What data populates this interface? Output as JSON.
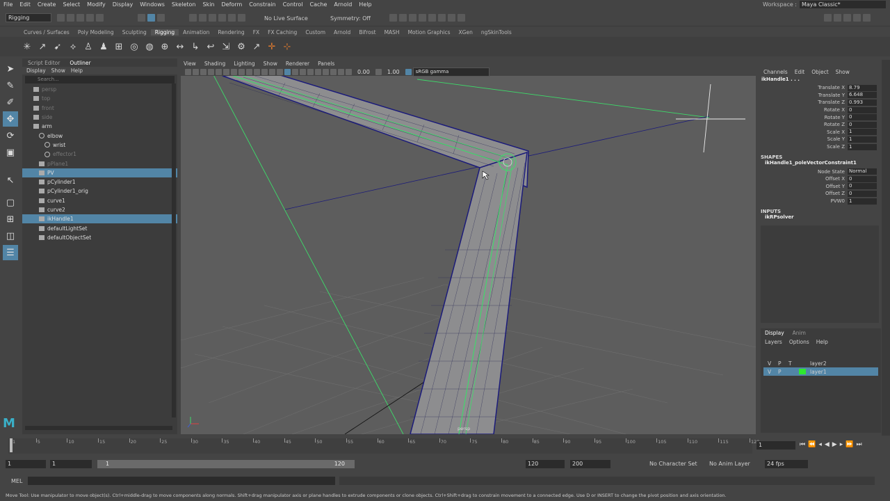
{
  "menu": [
    "File",
    "Edit",
    "Create",
    "Select",
    "Modify",
    "Display",
    "Windows",
    "Skeleton",
    "Skin",
    "Deform",
    "Constrain",
    "Control",
    "Cache",
    "Arnold",
    "Help"
  ],
  "workspace": {
    "label": "Workspace :",
    "value": "Maya Classic*"
  },
  "status": {
    "mode": "Rigging",
    "live_surface": "No Live Surface",
    "symmetry": "Symmetry: Off"
  },
  "shelf_tabs": [
    "Curves / Surfaces",
    "Poly Modeling",
    "Sculpting",
    "Rigging",
    "Animation",
    "Rendering",
    "FX",
    "FX Caching",
    "Custom",
    "Arnold",
    "Bifrost",
    "MASH",
    "Motion Graphics",
    "XGen",
    "ngSkinTools"
  ],
  "shelf_active": "Rigging",
  "outliner": {
    "tabs": [
      "Script Editor",
      "Outliner"
    ],
    "menu": [
      "Display",
      "Show",
      "Help"
    ],
    "search_placeholder": "Search...",
    "rows": [
      {
        "label": "persp",
        "indent": 1,
        "dim": true,
        "sel": false
      },
      {
        "label": "top",
        "indent": 1,
        "dim": true,
        "sel": false
      },
      {
        "label": "front",
        "indent": 1,
        "dim": true,
        "sel": false
      },
      {
        "label": "side",
        "indent": 1,
        "dim": true,
        "sel": false
      },
      {
        "label": "arm",
        "indent": 1,
        "dim": false,
        "sel": false
      },
      {
        "label": "elbow",
        "indent": 2,
        "dim": false,
        "sel": false
      },
      {
        "label": "wrist",
        "indent": 3,
        "dim": false,
        "sel": false
      },
      {
        "label": "effector1",
        "indent": 3,
        "dim": true,
        "sel": false
      },
      {
        "label": "pPlane1",
        "indent": 2,
        "dim": true,
        "sel": false
      },
      {
        "label": "PV",
        "indent": 2,
        "dim": false,
        "sel": true
      },
      {
        "label": "pCylinder1",
        "indent": 2,
        "dim": false,
        "sel": false
      },
      {
        "label": "pCylinder1_orig",
        "indent": 2,
        "dim": false,
        "sel": false
      },
      {
        "label": "curve1",
        "indent": 2,
        "dim": false,
        "sel": false
      },
      {
        "label": "curve2",
        "indent": 2,
        "dim": false,
        "sel": false
      },
      {
        "label": "ikHandle1",
        "indent": 2,
        "dim": false,
        "sel": true
      },
      {
        "label": "defaultLightSet",
        "indent": 2,
        "dim": false,
        "sel": false
      },
      {
        "label": "defaultObjectSet",
        "indent": 2,
        "dim": false,
        "sel": false
      }
    ]
  },
  "viewport": {
    "menu": [
      "View",
      "Shading",
      "Lighting",
      "Show",
      "Renderer",
      "Panels"
    ],
    "exposure": "0.00",
    "gamma": "1.00",
    "colorspace": "sRGB gamma",
    "camera": "persp"
  },
  "channels": {
    "menu": [
      "Channels",
      "Edit",
      "Object",
      "Show"
    ],
    "node": "ikHandle1 . . .",
    "attrs": [
      {
        "name": "Translate X",
        "value": "8.79"
      },
      {
        "name": "Translate Y",
        "value": "6.648"
      },
      {
        "name": "Translate Z",
        "value": "0.993"
      },
      {
        "name": "Rotate X",
        "value": "0"
      },
      {
        "name": "Rotate Y",
        "value": "0"
      },
      {
        "name": "Rotate Z",
        "value": "0"
      },
      {
        "name": "Scale X",
        "value": "1"
      },
      {
        "name": "Scale Y",
        "value": "1"
      },
      {
        "name": "Scale Z",
        "value": "1"
      }
    ],
    "shapes_header": "SHAPES",
    "shape_node": "ikHandle1_poleVectorConstraint1",
    "shape_attrs": [
      {
        "name": "Node State",
        "value": "Normal"
      },
      {
        "name": "Offset X",
        "value": "0"
      },
      {
        "name": "Offset Y",
        "value": "0"
      },
      {
        "name": "Offset Z",
        "value": "0"
      },
      {
        "name": "PVW0",
        "value": "1"
      }
    ],
    "inputs_header": "INPUTS",
    "input_node": "ikRPsolver"
  },
  "layers": {
    "tabs": [
      "Display",
      "Anim"
    ],
    "menu": [
      "Layers",
      "Options",
      "Help"
    ],
    "rows": [
      {
        "v": "V",
        "p": "P",
        "t": "T",
        "name": "layer2",
        "color": "",
        "sel": false
      },
      {
        "v": "V",
        "p": "P",
        "t": "",
        "name": "layer1",
        "color": "#2ee82e",
        "sel": true
      }
    ]
  },
  "timeline": {
    "ticks": [
      "1",
      "5",
      "10",
      "15",
      "20",
      "25",
      "30",
      "35",
      "40",
      "45",
      "50",
      "55",
      "60",
      "65",
      "70",
      "75",
      "80",
      "85",
      "90",
      "95",
      "100",
      "105",
      "110",
      "115",
      "120"
    ],
    "current": "1"
  },
  "range": {
    "start": "1",
    "inner_start": "1",
    "slider_start": "1",
    "slider_end": "120",
    "end": "120",
    "anim_end": "200",
    "char_set": "No Character Set",
    "anim_layer": "No Anim Layer",
    "fps": "24 fps"
  },
  "cmd": {
    "lang": "MEL"
  },
  "help_text": "Move Tool: Use manipulator to move object(s). Ctrl+middle-drag to move components along normals. Shift+drag manipulator axis or plane handles to extrude components or clone objects. Ctrl+Shift+drag to constrain movement to a connected edge. Use D or INSERT to change the pivot position and axis orientation.",
  "colors": {
    "selection": "#5285a6",
    "wire_green": "#3ddc6a",
    "wire_blue": "#1b1b7a",
    "viewport_bg": "#5d5d5d"
  }
}
